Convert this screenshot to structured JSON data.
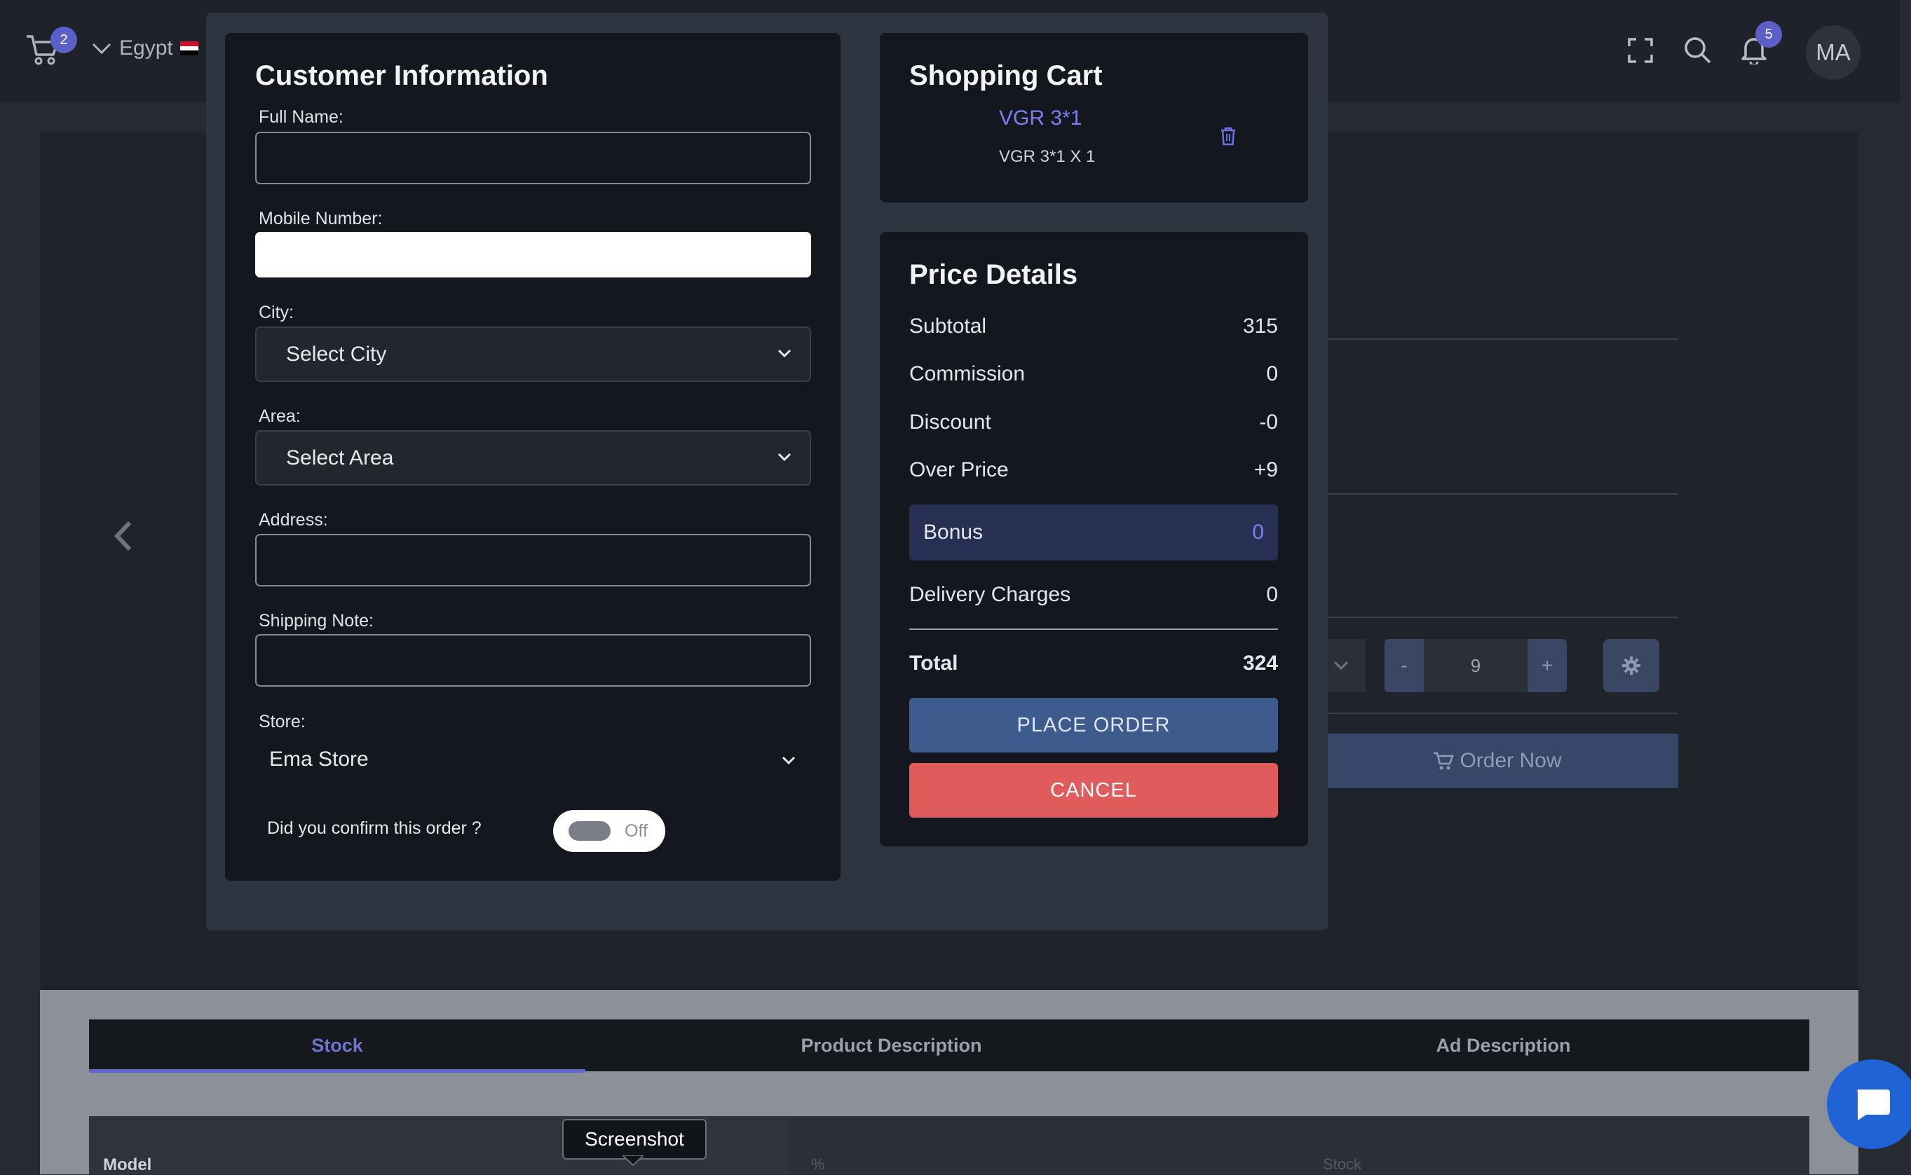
{
  "header": {
    "cart_badge": "2",
    "country": "Egypt",
    "notification_badge": "5",
    "avatar_initials": "MA"
  },
  "background": {
    "quantity_minus": "-",
    "quantity_value": "9",
    "quantity_plus": "+",
    "order_now_label": "Order Now",
    "tabs": [
      "Stock",
      "Product Description",
      "Ad Description"
    ],
    "table_headers": {
      "model": "Model",
      "percent": "%",
      "stock": "Stock"
    },
    "tooltip": "Screenshot"
  },
  "customer_info": {
    "title": "Customer Information",
    "full_name_label": "Full Name:",
    "mobile_label": "Mobile Number:",
    "city_label": "City:",
    "city_value": "Select City",
    "area_label": "Area:",
    "area_value": "Select Area",
    "address_label": "Address:",
    "shipping_note_label": "Shipping Note:",
    "store_label": "Store:",
    "store_value": "Ema Store",
    "confirm_question": "Did you confirm this order ?",
    "confirm_toggle": "Off"
  },
  "shopping_cart": {
    "title": "Shopping Cart",
    "item_name": "VGR 3*1",
    "item_detail": "VGR 3*1 X 1"
  },
  "price_details": {
    "title": "Price Details",
    "subtotal_label": "Subtotal",
    "subtotal": "315",
    "commission_label": "Commission",
    "commission": "0",
    "discount_label": "Discount",
    "discount": "-0",
    "over_price_label": "Over Price",
    "over_price": "+9",
    "bonus_label": "Bonus",
    "bonus": "0",
    "delivery_label": "Delivery Charges",
    "delivery": "0",
    "total_label": "Total",
    "total": "324",
    "place_order": "PLACE ORDER",
    "cancel": "CANCEL"
  },
  "colors": {
    "accent": "#5b5fc7",
    "place_order": "#3e5b8e",
    "cancel": "#e05b5b",
    "chat_fab": "#1f63d6"
  }
}
